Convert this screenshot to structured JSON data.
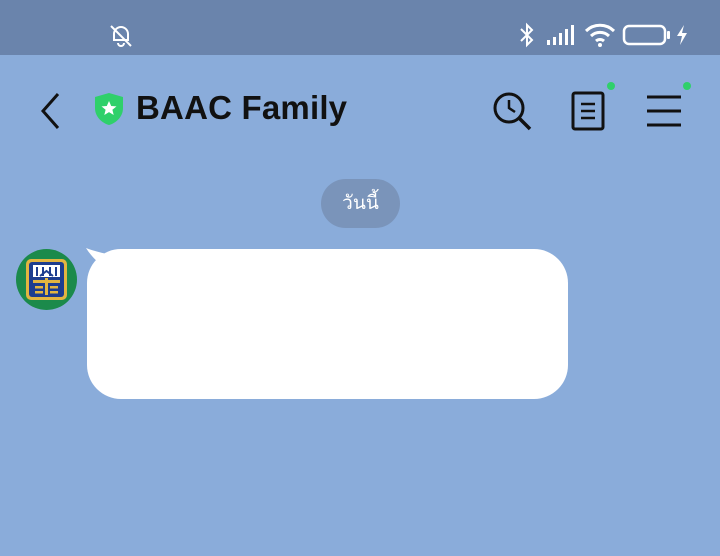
{
  "status_bar": {
    "icons": [
      "bell-off-icon",
      "bluetooth-icon",
      "signal-icon",
      "wifi-icon",
      "battery-icon",
      "charging-icon"
    ],
    "background": "#6a84ac"
  },
  "header": {
    "title": "BAAC Family",
    "verified_badge_color": "#2fd06a",
    "icons": [
      "back-icon",
      "verified-shield-icon",
      "search-history-icon",
      "notes-icon",
      "menu-icon"
    ],
    "notification_dot_color": "#2fd06a"
  },
  "chat": {
    "background": "#8aacda",
    "date_separator": "วันนี้",
    "messages": [
      {
        "sender_avatar": "baac-logo-icon",
        "text": ""
      }
    ]
  }
}
